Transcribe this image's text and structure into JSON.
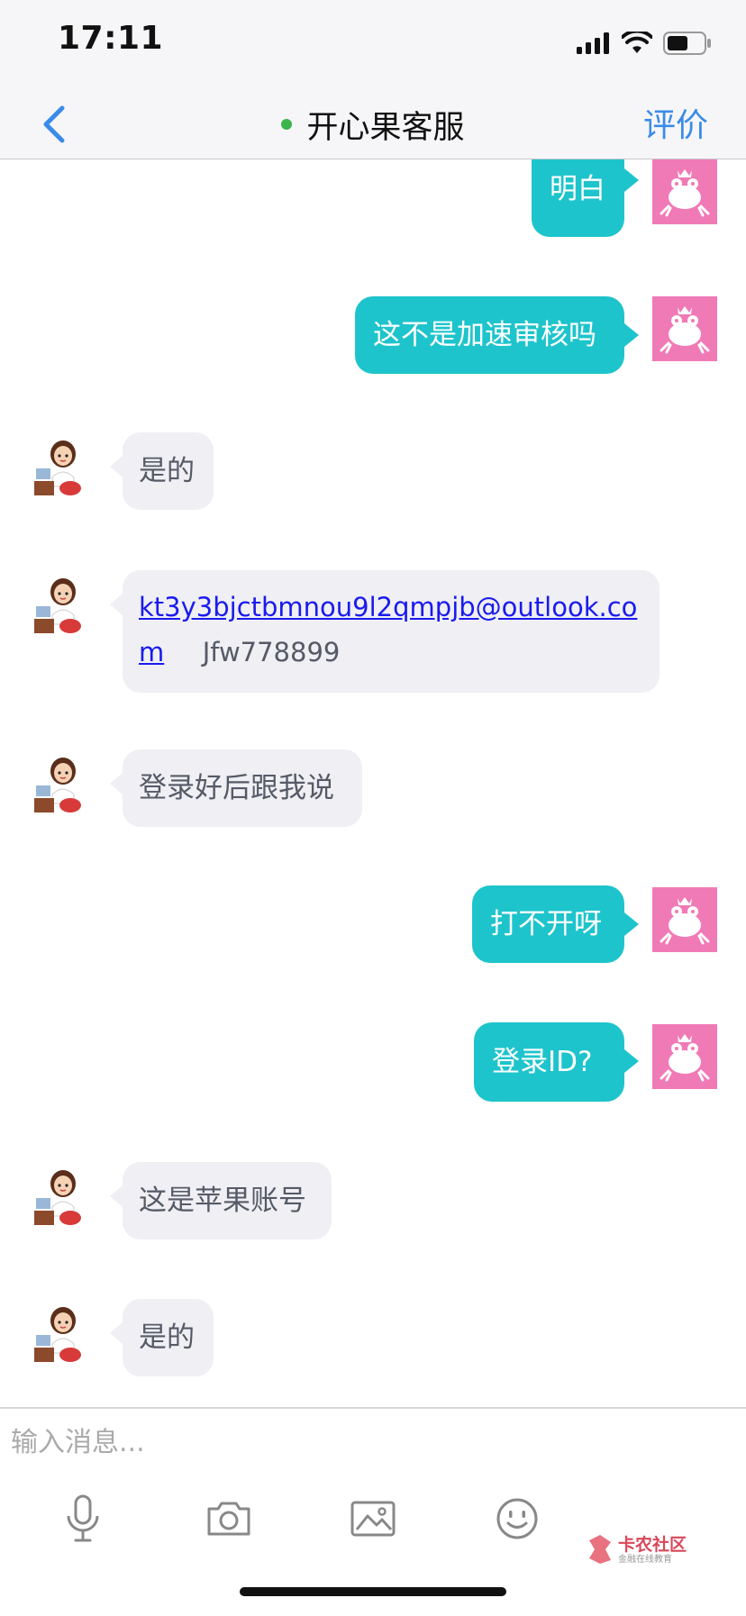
{
  "status_bar": {
    "time": "17:11"
  },
  "nav": {
    "title": "开心果客服",
    "rate_label": "评价"
  },
  "messages": [
    {
      "from": "user",
      "text": "明白"
    },
    {
      "from": "user",
      "text": "这不是加速审核吗"
    },
    {
      "from": "agent",
      "text": "是的"
    },
    {
      "from": "agent",
      "link_line1": "kt3y3bjctbmnou9l2qmpjb@outlook.co",
      "link_line2": "m",
      "extra": "Jfw778899"
    },
    {
      "from": "agent",
      "text": "登录好后跟我说"
    },
    {
      "from": "user",
      "text": "打不开呀"
    },
    {
      "from": "user",
      "text": "登录ID?"
    },
    {
      "from": "agent",
      "text": "这是苹果账号"
    },
    {
      "from": "agent",
      "text": "是的"
    }
  ],
  "composer": {
    "placeholder": "输入消息...",
    "tools": [
      "microphone-icon",
      "camera-icon",
      "image-icon",
      "emoji-icon"
    ]
  },
  "watermark": {
    "title": "卡农社区",
    "subtitle": "金融在线教育"
  },
  "colors": {
    "user_bubble": "#1ec4cc",
    "agent_bubble": "#efeff4",
    "accent": "#3a8be8",
    "online": "#3bb54a",
    "user_avatar": "#f07ab6"
  }
}
